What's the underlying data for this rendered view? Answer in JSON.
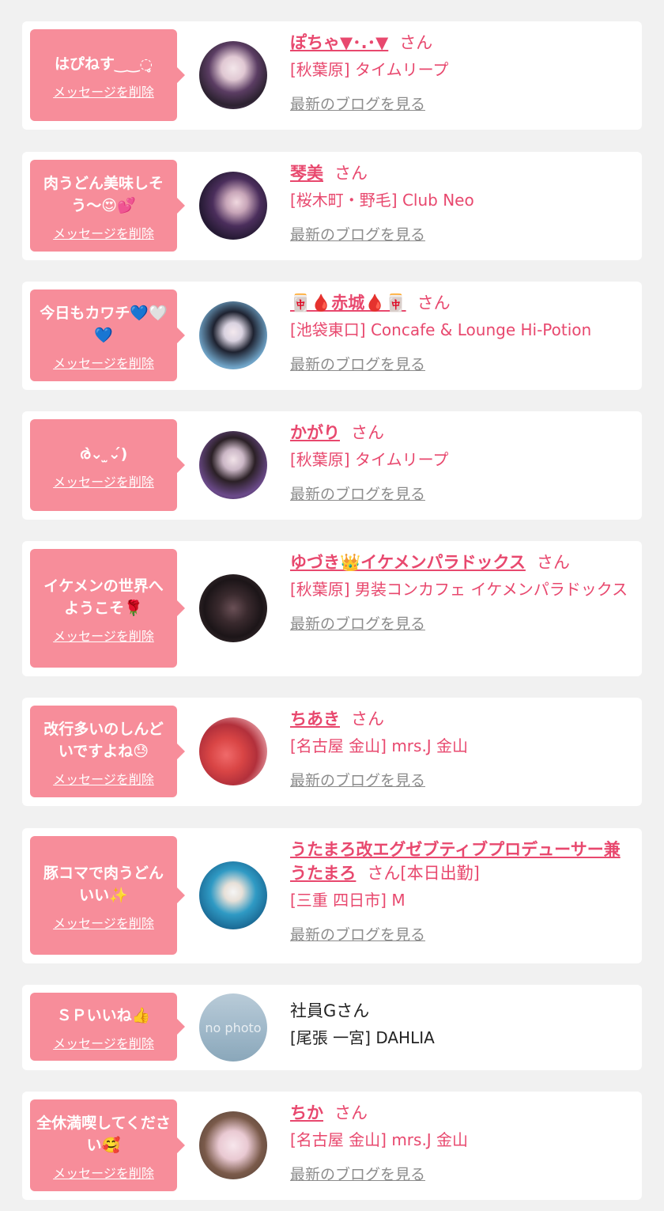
{
  "common": {
    "delete_label": "メッセージを削除",
    "blog_label": "最新のブログを見る",
    "san_label": "さん"
  },
  "colors": {
    "accent_pink": "#e8486e",
    "bubble_pink": "#f78d9a",
    "muted_gray": "#8c8c8c",
    "background": "#f1f1f1"
  },
  "messages": [
    {
      "message": "はぴねす‿‿◌̥",
      "name": "ぽちゃ▼･.･▼",
      "suffix": "さん",
      "shop": "[秋葉原] タイムリープ",
      "avatar_icon": "girl-photo"
    },
    {
      "message": "肉うどん美味しそう〜😍💕",
      "name": "琴美",
      "suffix": "さん",
      "shop": "[桜木町・野毛] Club Neo",
      "avatar_icon": "girl-photo"
    },
    {
      "message": "今日もカワチ💙🤍💙",
      "name": "🀄🩸赤城🩸🀄",
      "suffix": "さん",
      "shop": "[池袋東口] Concafe & Lounge Hi-Potion",
      "avatar_icon": "girl-photo"
    },
    {
      "message": "ര̀⌄ ̫⌄́)",
      "name": "かがり",
      "suffix": "さん",
      "shop": "[秋葉原] タイムリープ",
      "avatar_icon": "girl-photo"
    },
    {
      "message": "イケメンの世界へようこそ🌹",
      "name": "ゆづき👑イケメンパラドックス",
      "suffix": "さん",
      "shop": "[秋葉原] 男装コンカフェ イケメンパラドックス",
      "avatar_icon": "group-photo"
    },
    {
      "message": "改行多いのしんどいですよね😓",
      "name": "ちあき",
      "suffix": "さん",
      "shop": "[名古屋 金山] mrs.J 金山",
      "avatar_icon": "flower-photo"
    },
    {
      "message": "豚コマで肉うどんいい✨",
      "name": "うたまろ改エグゼブティブプロデューサー兼うたまろ",
      "suffix": "さん[本日出勤]",
      "shop": "[三重 四日市] M",
      "avatar_icon": "sunglasses-photo"
    },
    {
      "message": "ＳＰいいね👍",
      "name": "社員G",
      "suffix": "さん",
      "shop": "[尾張 一宮] DAHLIA",
      "avatar_icon": "no-photo",
      "avatar_text": "no photo"
    },
    {
      "message": "全休満喫してください🥰",
      "name": "ちか",
      "suffix": "さん",
      "shop": "[名古屋 金山] mrs.J 金山",
      "avatar_icon": "girl-photo-blurred"
    }
  ]
}
